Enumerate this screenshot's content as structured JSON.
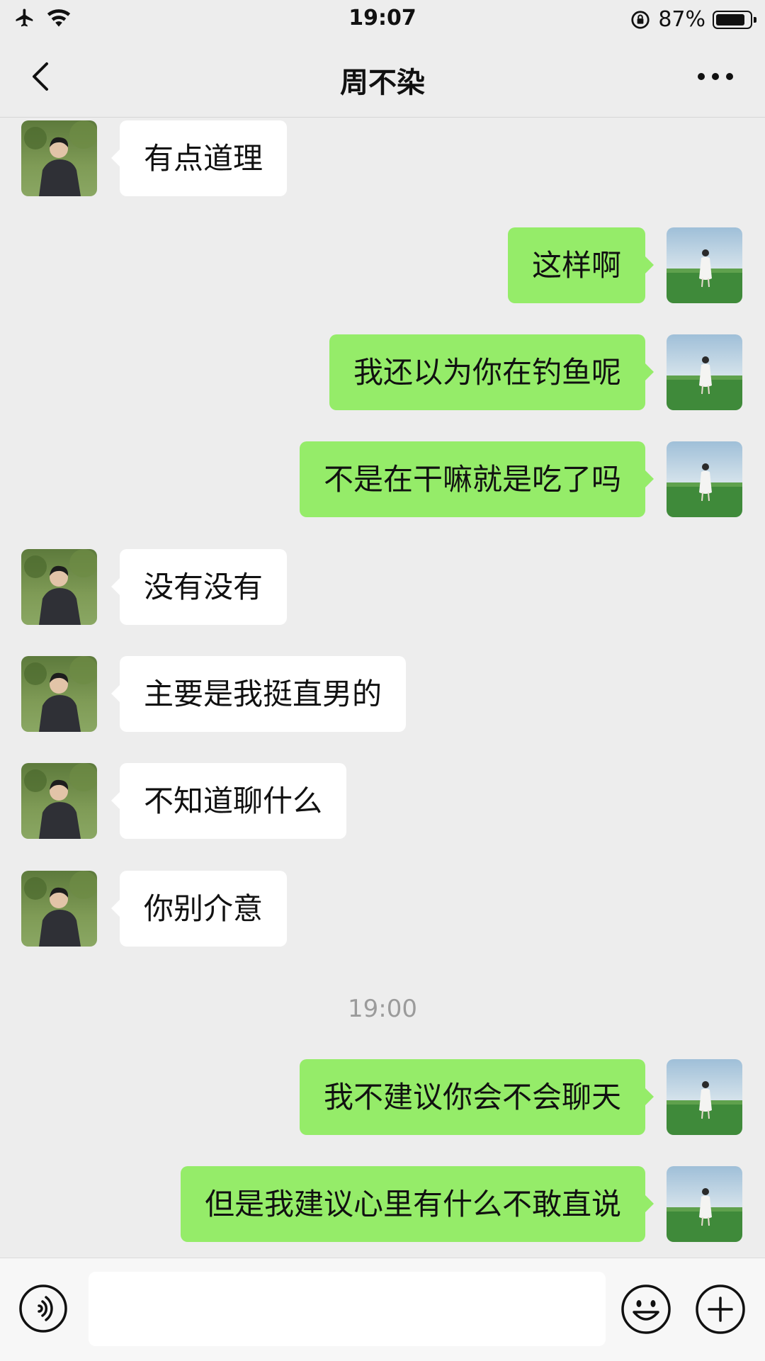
{
  "status": {
    "time": "19:07",
    "battery": "87%",
    "battery_level": 0.87
  },
  "header": {
    "title": "周不染"
  },
  "messages": [
    {
      "side": "left",
      "text": "有点道理"
    },
    {
      "side": "right",
      "text": "这样啊"
    },
    {
      "side": "right",
      "text": "我还以为你在钓鱼呢"
    },
    {
      "side": "right",
      "text": "不是在干嘛就是吃了吗"
    },
    {
      "side": "left",
      "text": "没有没有"
    },
    {
      "side": "left",
      "text": "主要是我挺直男的"
    },
    {
      "side": "left",
      "text": "不知道聊什么"
    },
    {
      "side": "left",
      "text": "你别介意"
    },
    {
      "type": "time",
      "text": "19:00"
    },
    {
      "side": "right",
      "text": "我不建议你会不会聊天"
    },
    {
      "side": "right",
      "text": "但是我建议心里有什么不敢直说"
    }
  ],
  "input": {
    "value": ""
  },
  "icons": {
    "back": "back-chevron-icon",
    "more": "more-dots-icon",
    "voice": "voice-icon",
    "emoji": "emoji-icon",
    "plus": "plus-icon",
    "airplane": "airplane-icon",
    "wifi": "wifi-icon",
    "rotation_lock": "rotation-lock-icon"
  },
  "colors": {
    "background": "#ededed",
    "outgoing_bubble": "#95ec69",
    "incoming_bubble": "#ffffff"
  }
}
